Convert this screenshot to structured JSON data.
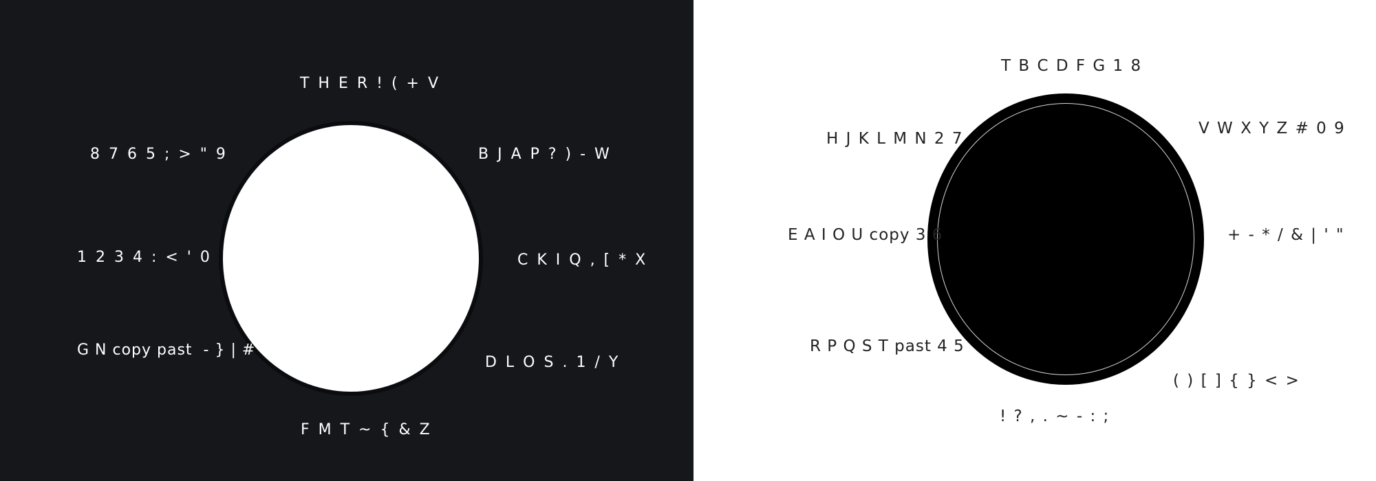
{
  "left_wheel": {
    "sectors": [
      {
        "id": "top",
        "label": "T H E R ! ( + V"
      },
      {
        "id": "top-right",
        "label": "B J A P ? ) - W"
      },
      {
        "id": "right",
        "label": "C K I Q , [ * X"
      },
      {
        "id": "bottom-right",
        "label": "D L O S . 1 / Y"
      },
      {
        "id": "bottom",
        "label": "F M T ~ { & Z"
      },
      {
        "id": "bottom-left",
        "label": "G N copy past  - } | #"
      },
      {
        "id": "left",
        "label": "1 2 3 4 : < ' 0"
      },
      {
        "id": "top-left",
        "label": "8 7 6 5 ; > \" 9"
      }
    ]
  },
  "right_wheel": {
    "sectors": [
      {
        "id": "top",
        "label": "T B C D F G 1 8"
      },
      {
        "id": "top-right",
        "label": "V W X Y Z # 0 9"
      },
      {
        "id": "right",
        "label": "+ - * / & | ' \""
      },
      {
        "id": "bottom-right",
        "label": "( ) [ ] { } < >"
      },
      {
        "id": "bottom",
        "label": "! ? , . ~ - : ;"
      },
      {
        "id": "bottom-left",
        "label": "R P Q S T past 4 5"
      },
      {
        "id": "left",
        "label": "E A I O U copy 3 6"
      },
      {
        "id": "top-left",
        "label": "H J K L M N 2 7"
      }
    ]
  }
}
